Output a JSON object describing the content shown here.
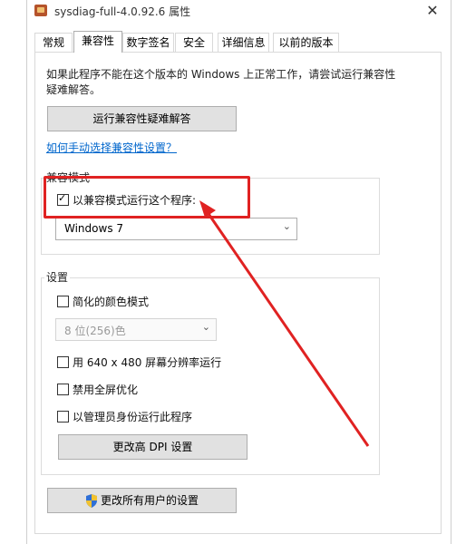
{
  "window": {
    "title": "sysdiag-full-4.0.92.6 属性",
    "close_glyph": "✕"
  },
  "tabs": [
    {
      "label": "常规"
    },
    {
      "label": "兼容性"
    },
    {
      "label": "数字签名"
    },
    {
      "label": "安全"
    },
    {
      "label": "详细信息"
    },
    {
      "label": "以前的版本"
    }
  ],
  "compat": {
    "description": "如果此程序不能在这个版本的 Windows 上正常工作，请尝试运行兼容性疑难解答。",
    "troubleshooter_button": "运行兼容性疑难解答",
    "manual_link": "如何手动选择兼容性设置？"
  },
  "compat_mode": {
    "group_label": "兼容模式",
    "checkbox_label": "以兼容模式运行这个程序:",
    "checked": true,
    "os_value": "Windows 7"
  },
  "settings": {
    "group_label": "设置",
    "reduced_color_label": "简化的颜色模式",
    "color_value": "8 位(256)色",
    "res_640_label": "用 640 x 480 屏幕分辨率运行",
    "disable_fullscreen_label": "禁用全屏优化",
    "run_as_admin_label": "以管理员身份运行此程序",
    "dpi_button": "更改高 DPI 设置"
  },
  "all_users_button": "更改所有用户的设置",
  "colors": {
    "annotation_red": "#e02222",
    "link_blue": "#0066cc"
  }
}
